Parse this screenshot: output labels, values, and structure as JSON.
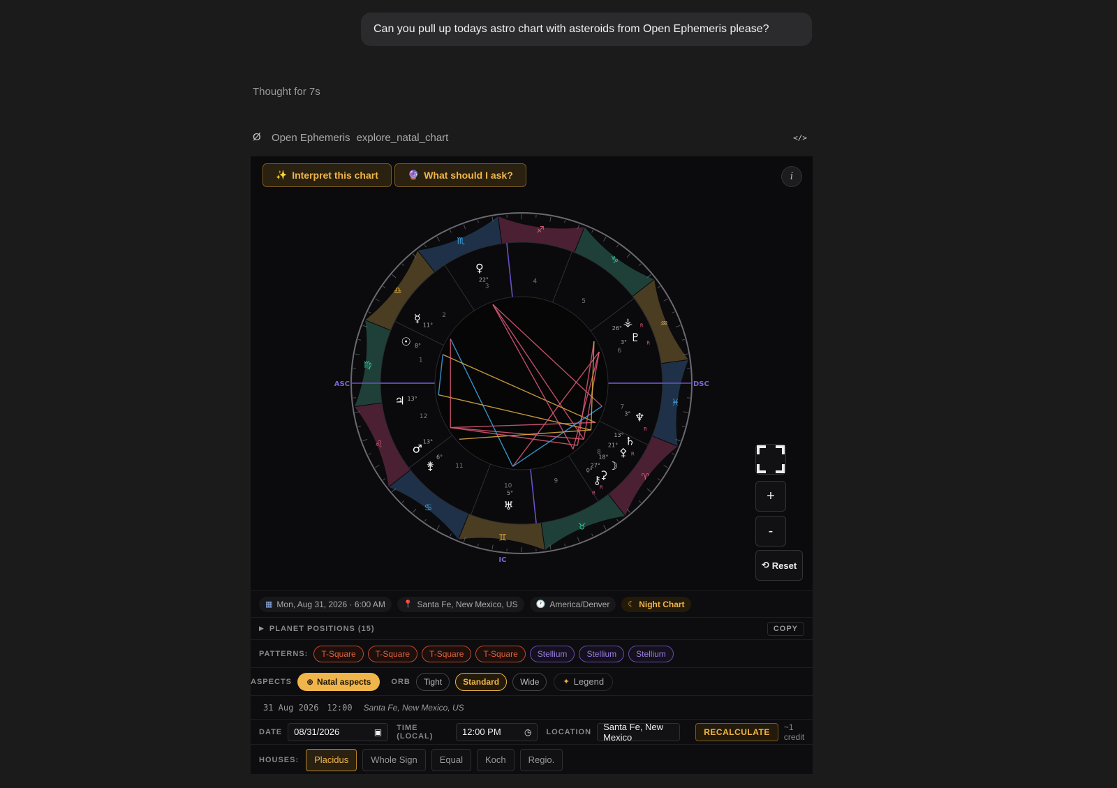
{
  "user_message": "Can you pull up todays astro chart with asteroids from Open Ephemeris please?",
  "thought": "Thought for 7s",
  "tool": {
    "provider": "Open Ephemeris",
    "name": "explore_natal_chart",
    "code_icon": "</>"
  },
  "actions": {
    "interpret": "Interpret this chart",
    "ask": "What should I ask?",
    "info": "i"
  },
  "chart": {
    "axes": {
      "mc": "MC",
      "ic": "IC",
      "asc": "ASC",
      "dsc": "DSC"
    },
    "signs": [
      "♈",
      "♉",
      "♊",
      "♋",
      "♌",
      "♍",
      "♎",
      "♏",
      "♐",
      "♑",
      "♒",
      "♓"
    ],
    "sign_colors": {
      "fire": "#e05a78",
      "earth": "#2fc4a0",
      "air": "#e0b040",
      "water": "#3fa8e8"
    },
    "houses": [
      "1",
      "2",
      "3",
      "4",
      "5",
      "6",
      "7",
      "8",
      "9",
      "10",
      "11",
      "12"
    ],
    "planets": [
      {
        "name": "Sun",
        "glyph": "☉",
        "deg": "8°"
      },
      {
        "name": "Mercury",
        "glyph": "☿",
        "deg": "11°"
      },
      {
        "name": "Venus",
        "glyph": "♀",
        "deg": "22°"
      },
      {
        "name": "Mars",
        "glyph": "♂",
        "deg": "13°"
      },
      {
        "name": "Juno",
        "glyph": "⚵",
        "deg": "6°"
      },
      {
        "name": "Jupiter",
        "glyph": "♃",
        "deg": "13°"
      },
      {
        "name": "Uranus",
        "glyph": "♅",
        "deg": "5°"
      },
      {
        "name": "Chiron",
        "glyph": "⚷",
        "deg": "0°",
        "retro": "R"
      },
      {
        "name": "Ceres",
        "glyph": "⚳",
        "deg": "27°",
        "retro": "R"
      },
      {
        "name": "Moon",
        "glyph": "☽",
        "deg": "18°"
      },
      {
        "name": "Pallas",
        "glyph": "⚴",
        "deg": "21°"
      },
      {
        "name": "Saturn",
        "glyph": "♄",
        "deg": "13°",
        "retro": "R"
      },
      {
        "name": "Neptune",
        "glyph": "♆",
        "deg": "3°",
        "retro": "R"
      },
      {
        "name": "Pluto",
        "glyph": "♇",
        "deg": "3°",
        "retro": "R"
      },
      {
        "name": "Vesta",
        "glyph": "⚶",
        "deg": "26°",
        "retro": "R"
      }
    ]
  },
  "controls": {
    "zoom_in": "+",
    "zoom_out": "-",
    "reset": "Reset"
  },
  "meta": {
    "date": "Mon, Aug 31, 2026 · 6:00 AM",
    "place": "Santa Fe, New Mexico, US",
    "tz": "America/Denver",
    "night": "Night Chart"
  },
  "positions": {
    "label": "PLANET POSITIONS (15)",
    "copy": "COPY"
  },
  "patterns": {
    "label": "PATTERNS:",
    "items": [
      "T-Square",
      "T-Square",
      "T-Square",
      "T-Square",
      "Stellium",
      "Stellium",
      "Stellium"
    ]
  },
  "aspects": {
    "label": "ASPECTS",
    "natal": "Natal aspects",
    "orb_label": "ORB",
    "orbs": [
      "Tight",
      "Standard",
      "Wide"
    ],
    "legend": "Legend"
  },
  "summary": {
    "date": "31 Aug 2026",
    "time": "12:00",
    "place": "Santa Fe, New Mexico, US"
  },
  "form": {
    "date_label": "DATE",
    "date_value": "08/31/2026",
    "time_label": "TIME (LOCAL)",
    "time_value": "12:00 PM",
    "location_label": "LOCATION",
    "location_value": "Santa Fe, New Mexico",
    "recalc": "RECALCULATE",
    "credit": "~1 credit"
  },
  "houses": {
    "label": "HOUSES:",
    "systems": [
      "Placidus",
      "Whole Sign",
      "Equal",
      "Koch",
      "Regio."
    ]
  }
}
